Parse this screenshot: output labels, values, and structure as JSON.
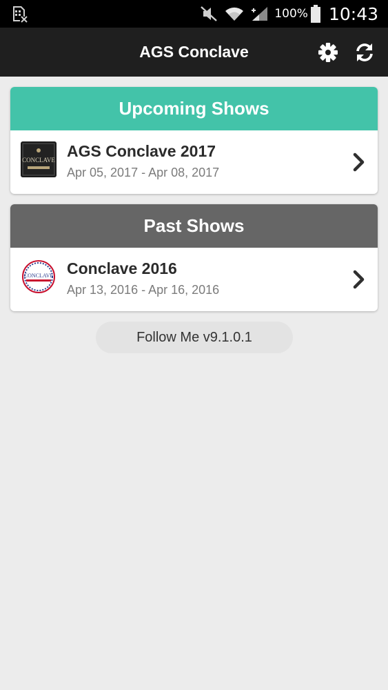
{
  "status_bar": {
    "battery_percent": "100%",
    "time": "10:43"
  },
  "app_bar": {
    "title": "AGS Conclave"
  },
  "upcoming": {
    "header": "Upcoming Shows",
    "items": [
      {
        "title": "AGS Conclave 2017",
        "dates": "Apr 05, 2017 - Apr 08, 2017",
        "logo_text": "CONCLAVE"
      }
    ]
  },
  "past": {
    "header": "Past Shows",
    "items": [
      {
        "title": "Conclave 2016",
        "dates": "Apr 13, 2016 - Apr 16, 2016",
        "logo_text": "CONCLAVE"
      }
    ]
  },
  "footer": {
    "version": "Follow Me v9.1.0.1"
  },
  "colors": {
    "upcoming_header": "#43c3a9",
    "past_header": "#666666",
    "app_bar": "#1f1f1f",
    "background": "#ececec"
  }
}
